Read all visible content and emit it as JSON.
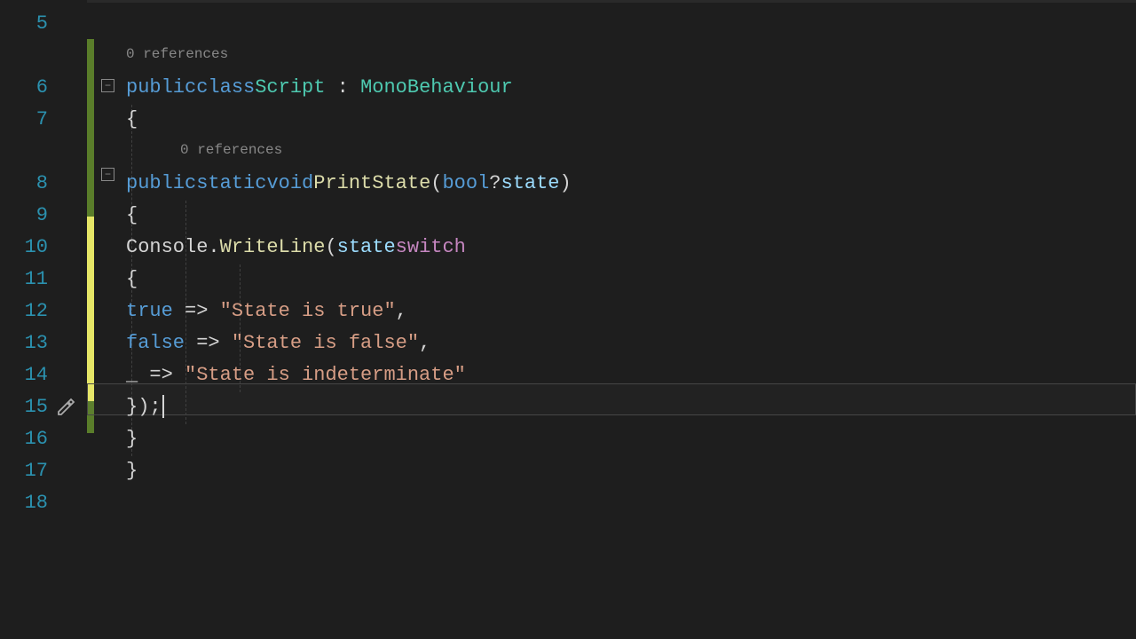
{
  "lines": {
    "5": "5",
    "6": "6",
    "7": "7",
    "8": "8",
    "9": "9",
    "10": "10",
    "11": "11",
    "12": "12",
    "13": "13",
    "14": "14",
    "15": "15",
    "16": "16",
    "17": "17",
    "18": "18"
  },
  "codelens": {
    "class": "0 references",
    "method": "0 references"
  },
  "code": {
    "l6": {
      "public": "public",
      "class": "class",
      "name": "Script",
      "colon": " : ",
      "base": "MonoBehaviour"
    },
    "l7": "{",
    "l8": {
      "public": "public",
      "static": "static",
      "void": "void",
      "method": "PrintState",
      "lparen": "(",
      "type": "bool",
      "nullable": "?",
      "param": "state",
      "rparen": ")"
    },
    "l9": "{",
    "l10": {
      "console": "Console",
      "dot": ".",
      "writeline": "WriteLine",
      "lparen": "(",
      "state": "state",
      "switch": "switch"
    },
    "l11": "{",
    "l12": {
      "true": "true",
      "arrow": " => ",
      "str": "\"State is true\"",
      "comma": ","
    },
    "l13": {
      "false": "false",
      "arrow": " => ",
      "str": "\"State is false\"",
      "comma": ","
    },
    "l14": {
      "underscore": "_",
      "arrow": " => ",
      "str": "\"State is indeterminate\""
    },
    "l15": "});",
    "l16": "}",
    "l17": "}"
  }
}
